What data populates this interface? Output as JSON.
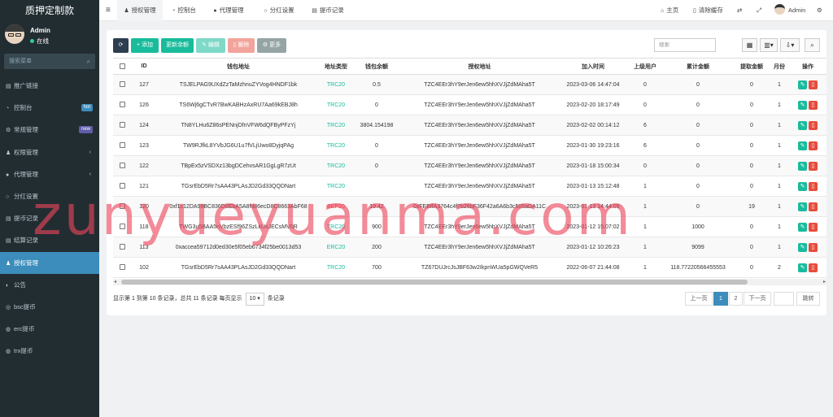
{
  "app": {
    "title": "质押定制款"
  },
  "user": {
    "name": "Admin",
    "status": "在线"
  },
  "sidebar": {
    "search_placeholder": "搜索菜单",
    "items": [
      {
        "label": "推广链接",
        "icon": "list-icon",
        "ico": "▤"
      },
      {
        "label": "控制台",
        "icon": "dashboard-icon",
        "ico": "◔",
        "badge": "hot",
        "badge_color": "#3c8dbc"
      },
      {
        "label": "常规管理",
        "icon": "cogs-icon",
        "ico": "⚙",
        "badge": "new",
        "badge_color": "#605ca8"
      },
      {
        "label": "权限管理",
        "icon": "group-icon",
        "ico": "♟",
        "arrow": "‹"
      },
      {
        "label": "代理管理",
        "icon": "user-icon",
        "ico": "●",
        "arrow": "‹"
      },
      {
        "label": "分红设置",
        "icon": "circle-icon",
        "ico": "○"
      },
      {
        "label": "提币记录",
        "icon": "list-icon",
        "ico": "▤"
      },
      {
        "label": "结算记录",
        "icon": "list-icon",
        "ico": "▤"
      },
      {
        "label": "授权管理",
        "icon": "user-icon",
        "ico": "♟",
        "active": true
      },
      {
        "label": "公告",
        "icon": "circle-icon",
        "ico": "◐"
      },
      {
        "label": "bsc提币",
        "icon": "bicycle-icon",
        "ico": "◎"
      },
      {
        "label": "erc提币",
        "icon": "circle-icon",
        "ico": "◍"
      },
      {
        "label": "trx提币",
        "icon": "circle-icon",
        "ico": "◍"
      }
    ]
  },
  "topbar": {
    "menu_icon": "bars-icon",
    "tabs": [
      {
        "label": "授权管理",
        "ico": "♟",
        "active": true
      },
      {
        "label": "控制台",
        "ico": "◔"
      },
      {
        "label": "代理管理",
        "ico": "●"
      },
      {
        "label": "分红设置",
        "ico": "○"
      },
      {
        "label": "提币记录",
        "ico": "▤"
      }
    ],
    "right": {
      "home": "主页",
      "clear": "清除缓存",
      "user": "Admin"
    }
  },
  "toolbar": {
    "refresh_icon": "refresh-icon",
    "add": "添加",
    "update_balance": "更新余额",
    "edit": "编辑",
    "delete": "删除",
    "more": "更多",
    "search_placeholder": "搜索",
    "colors": {
      "primary": "#2c3e50",
      "success": "#18bc9c",
      "danger": "#e74c3c",
      "info": "#3c8dbc",
      "muted": "#95a5a6"
    }
  },
  "table": {
    "columns": [
      "ID",
      "钱包地址",
      "地址类型",
      "钱包余额",
      "授权地址",
      "加入时间",
      "上级用户",
      "累计金额",
      "提取金额",
      "月份",
      "操作"
    ],
    "rows": [
      {
        "id": "127",
        "wallet": "TSJELPAG9UXdZzTaMzhnuZYVog4HNDF1bk",
        "type": "TRC20",
        "balance": "0.5",
        "auth": "TZC4EEr3hY9erJen6ew5hhXVJjZdMAha5T",
        "time": "2023-03-06 14:47:04",
        "parent": "0",
        "total": "0",
        "withdraw": "0",
        "month": "1"
      },
      {
        "id": "126",
        "wallet": "TS6Wj6gCTvR7BwKABHzAxRU7Aa69kEBJ8h",
        "type": "TRC20",
        "balance": "0",
        "auth": "TZC4EEr3hY9erJen6ew5hhXVJjZdMAha5T",
        "time": "2023-02-20 18:17:49",
        "parent": "0",
        "total": "0",
        "withdraw": "0",
        "month": "1"
      },
      {
        "id": "124",
        "wallet": "TN8YLHu6Z86sPENnjDfnVFW6dQFByPFzYj",
        "type": "TRC20",
        "balance": "3804.154198",
        "auth": "TZC4EEr3hY9erJen6ew5hhXVJjZdMAha5T",
        "time": "2023-02-02 00:14:12",
        "parent": "6",
        "total": "0",
        "withdraw": "0",
        "month": "1"
      },
      {
        "id": "123",
        "wallet": "TW9RJfkL8YVbJG6U1u7fVLjUwo8DyjqPAg",
        "type": "TRC20",
        "balance": "0",
        "auth": "TZC4EEr3hY9erJen6ew5hhXVJjZdMAha5T",
        "time": "2023-01-30 19:23:16",
        "parent": "6",
        "total": "0",
        "withdraw": "0",
        "month": "1"
      },
      {
        "id": "122",
        "wallet": "TBpEx5zVSDXz13bgDCehvsAR1GgLgR7zUt",
        "type": "TRC20",
        "balance": "0",
        "auth": "TZC4EEr3hY9erJen6ew5hhXVJjZdMAha5T",
        "time": "2023-01-18 15:00:34",
        "parent": "0",
        "total": "0",
        "withdraw": "0",
        "month": "1"
      },
      {
        "id": "121",
        "wallet": "TGsrEbD5Rr7sAA43PLAsJD2Gd33QQDNart",
        "type": "TRC20",
        "balance": "",
        "auth": "TZC4EEr3hY9erJen6ew5hhXVJjZdMAha5T",
        "time": "2023-01-13 15:12:48",
        "parent": "1",
        "total": "0",
        "withdraw": "0",
        "month": "1"
      },
      {
        "id": "120",
        "wallet": "0xf1c12DA99BC836D6EbA5A8fd86ecD8C8663AbF68",
        "type": "BEP20",
        "balance": "19.42",
        "auth": "0xFEBffA3764c4f7b26bF36F42a6A6b3c505aDA11C",
        "time": "2023-01-13 14:44:09",
        "parent": "1",
        "total": "0",
        "withdraw": "19",
        "month": "1"
      },
      {
        "id": "118",
        "wallet": "TWG3u5BAA5nVbzESf96ZSzLkUsJECsMV0R",
        "type": "TRC20",
        "balance": "900",
        "auth": "TZC4EEr3hY9erJen6ew5hhXVJjZdMAha5T",
        "time": "2023-01-12 15:07:02",
        "parent": "1",
        "total": "1000",
        "withdraw": "0",
        "month": "1"
      },
      {
        "id": "113",
        "wallet": "0xaccea59712d0ed30e5f05eb6734f25be0013d53",
        "type": "ERC20",
        "balance": "200",
        "auth": "TZC4EEr3hY9erJen6ew5hhXVJjZdMAha5T",
        "time": "2023-01-12 10:26:23",
        "parent": "1",
        "total": "9099",
        "withdraw": "0",
        "month": "1"
      },
      {
        "id": "102",
        "wallet": "TGsrEbD5Rr7sAA43PLAsJD2Gd33QQDNart",
        "type": "TRC20",
        "balance": "700",
        "auth": "TZ67DUJrcJsJBF63w2IkpnWUa5pGWQVeR5",
        "time": "2022-06-07 21:44:08",
        "parent": "1",
        "total": "118.77220566455553",
        "withdraw": "0",
        "month": "2"
      }
    ]
  },
  "pagination": {
    "info_prefix": "显示第 1 到第 10 条记录，总共 11 条记录 每页显示",
    "page_size": "10",
    "info_suffix": "条记录",
    "prev": "上一页",
    "p1": "1",
    "p2": "2",
    "next": "下一页",
    "jump": "跳转"
  },
  "watermark": "zunyueyuanma.com"
}
